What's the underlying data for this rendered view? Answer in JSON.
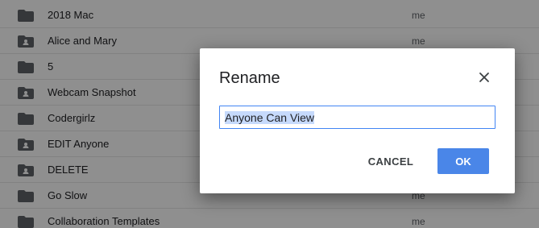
{
  "files": [
    {
      "name": "2018 Mac",
      "owner": "me",
      "icon": "folder-icon"
    },
    {
      "name": "Alice and Mary",
      "owner": "me",
      "icon": "shared-folder-icon"
    },
    {
      "name": "5",
      "owner": "",
      "icon": "folder-icon"
    },
    {
      "name": "Webcam Snapshot",
      "owner": "",
      "icon": "shared-folder-icon"
    },
    {
      "name": "Codergirlz",
      "owner": "",
      "icon": "folder-icon"
    },
    {
      "name": "EDIT Anyone",
      "owner": "",
      "icon": "shared-folder-icon"
    },
    {
      "name": "DELETE",
      "owner": "",
      "icon": "shared-folder-icon"
    },
    {
      "name": "Go Slow",
      "owner": "me",
      "icon": "folder-icon"
    },
    {
      "name": "Collaboration Templates",
      "owner": "me",
      "icon": "folder-icon"
    }
  ],
  "dialog": {
    "title": "Rename",
    "input_value": "Anyone Can View",
    "cancel_label": "CANCEL",
    "ok_label": "OK",
    "close_icon": "close-icon"
  },
  "colors": {
    "accent": "#4a86e8",
    "input_border": "#4285f4",
    "selection": "#c6dafc",
    "folder_icon": "#5f6368"
  }
}
